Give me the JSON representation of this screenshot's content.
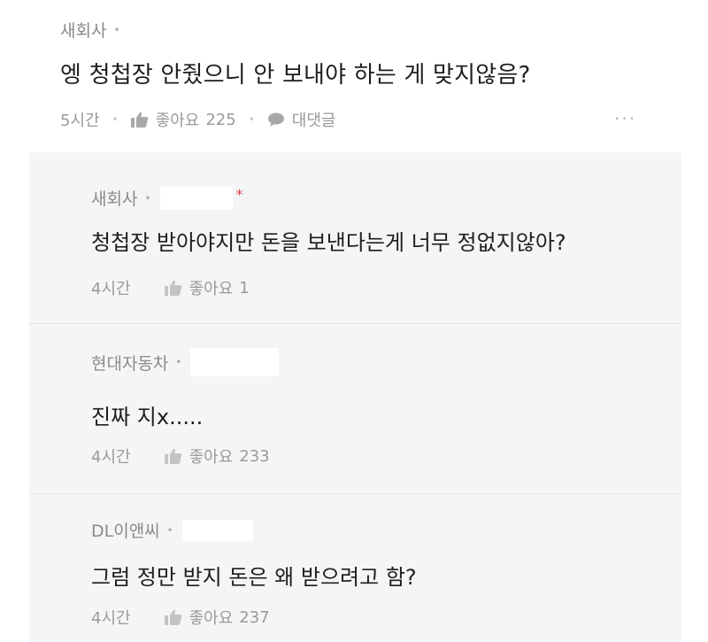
{
  "post": {
    "author": "새회사",
    "text": "엥 청첩장 안줬으니 안 보내야 하는 게 맞지않음?",
    "time": "5시간",
    "like_label": "좋아요",
    "like_count": "225",
    "reply_label": "대댓글",
    "more_label": "···"
  },
  "replies": [
    {
      "author": "새회사",
      "text": "청첩장 받아야지만 돈을 보낸다는게 너무 정없지않아?",
      "time": "4시간",
      "like_label": "좋아요",
      "like_count": "1",
      "badge": "*"
    },
    {
      "author": "현대자동차",
      "text": "진짜 지x.....",
      "time": "4시간",
      "like_label": "좋아요",
      "like_count": "233"
    },
    {
      "author": "DL이앤씨",
      "text": "그럼 정만 받지 돈은 왜 받으려고 함?",
      "time": "4시간",
      "like_label": "좋아요",
      "like_count": "237"
    }
  ],
  "colors": {
    "panel_bg": "#f4f5f7",
    "meta_text": "#8a8a8a",
    "badge": "#d8404a"
  }
}
